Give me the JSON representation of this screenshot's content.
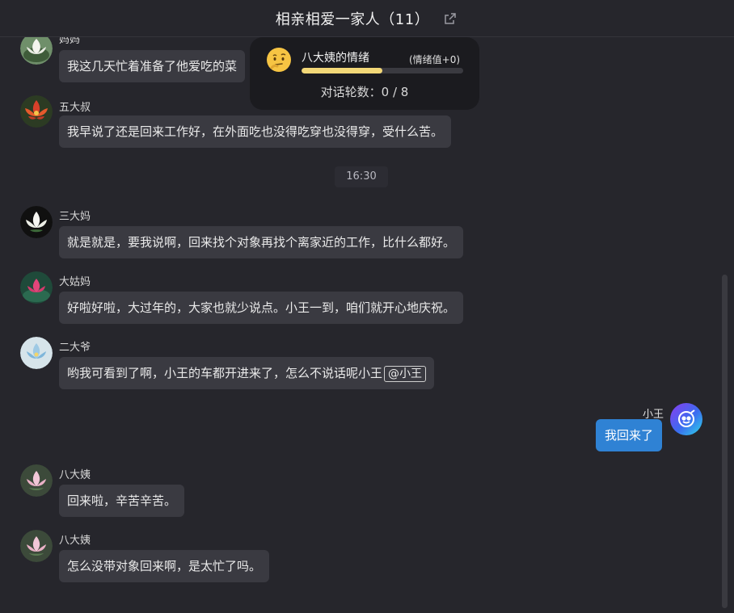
{
  "header": {
    "title": "相亲相爱一家人（11）",
    "share_icon": "share-icon"
  },
  "mood_panel": {
    "emoji_icon": "thinking-face-icon",
    "label": "八大姨的情绪",
    "value_text": "(情绪值+0)",
    "level": 0.5,
    "rounds_label": "对话轮数：",
    "rounds_value": "0 / 8",
    "fill_color": "#f3d878"
  },
  "timestamp": "16:30",
  "messages": [
    {
      "sender": "妈妈",
      "text": "我这几天忙着准备了他爱吃的菜",
      "avatar": "white-lotus-avatar"
    },
    {
      "sender": "五大叔",
      "text": "我早说了还是回来工作好，在外面吃也没得吃穿也没得穿，受什么苦。",
      "avatar": "red-flower-avatar"
    },
    {
      "sender": "三大妈",
      "text": "就是就是，要我说啊，回来找个对象再找个离家近的工作，比什么都好。",
      "avatar": "white-lotus-dark-avatar"
    },
    {
      "sender": "大姑妈",
      "text": "好啦好啦，大过年的，大家也就少说点。小王一到，咱们就开心地庆祝。",
      "avatar": "pink-lotus-avatar"
    },
    {
      "sender": "二大爷",
      "text": "哟我可看到了啊，小王的车都开进来了，怎么不说话呢小王",
      "mention": "@小王",
      "avatar": "blue-lotus-avatar"
    },
    {
      "sender": "八大姨",
      "text": "回来啦，辛苦辛苦。",
      "avatar": "pink-flower-avatar"
    },
    {
      "sender": "八大姨",
      "text": "怎么没带对象回来啊，是太忙了吗。",
      "avatar": "pink-flower-avatar"
    }
  ],
  "self_message": {
    "sender": "小王",
    "text": "我回来了",
    "avatar": "user-avatar-icon",
    "bubble_color": "#2f82d4"
  }
}
